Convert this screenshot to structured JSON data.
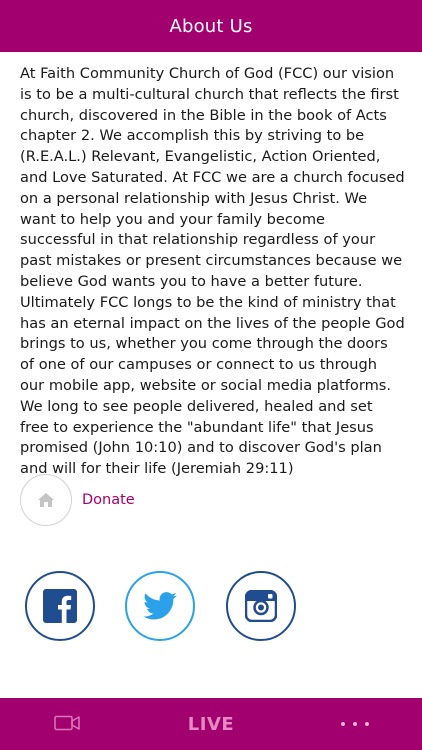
{
  "header": {
    "title": "About Us"
  },
  "about": {
    "body": "At Faith Community Church of God (FCC) our vision is to be a multi-cultural church that reflects the first church, discovered in the Bible in the book of Acts chapter 2. We accomplish this by striving to be (R.E.A.L.) Relevant, Evangelistic, Action Oriented, and Love Saturated. At FCC we are a church focused on a personal relationship with Jesus Christ. We want to help you and your family become successful in that relationship regardless of your past mistakes or present circumstances because we believe God wants you to have a better future. Ultimately FCC longs to be the kind of ministry that has an eternal impact on the lives of the people God brings to us, whether you come through the doors of one of our campuses or connect to us through our mobile app, website or social media platforms. We long to see people delivered, healed and set free to experience the \"abundant life\" that Jesus promised (John 10:10) and to discover God's plan and will for their life (Jeremiah 29:11)"
  },
  "donate": {
    "label": "Donate",
    "icon": "home-icon"
  },
  "social": [
    {
      "name": "facebook",
      "icon": "facebook-icon",
      "color": "#1f4d8f"
    },
    {
      "name": "twitter",
      "icon": "twitter-icon",
      "color": "#2aa1e8"
    },
    {
      "name": "instagram",
      "icon": "instagram-icon",
      "color": "#1f4d8f"
    }
  ],
  "bottom_nav": {
    "live_label": "LIVE",
    "video_icon": "video-camera-icon",
    "more_icon": "more-dots-icon"
  },
  "colors": {
    "brand": "#a3006f",
    "live_text": "#e38ac4"
  }
}
